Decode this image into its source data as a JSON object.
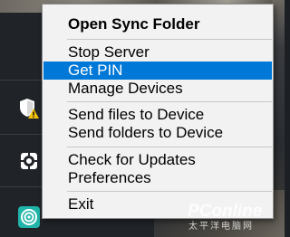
{
  "context_menu": {
    "groups": [
      {
        "items": [
          {
            "label": "Open Sync Folder",
            "bold": true
          }
        ]
      },
      {
        "items": [
          {
            "label": "Stop Server"
          },
          {
            "label": "Get PIN",
            "selected": true
          },
          {
            "label": "Manage Devices"
          }
        ]
      },
      {
        "items": [
          {
            "label": "Send files to Device"
          },
          {
            "label": "Send folders to Device"
          }
        ]
      },
      {
        "items": [
          {
            "label": "Check for Updates"
          },
          {
            "label": "Preferences"
          }
        ]
      },
      {
        "items": [
          {
            "label": "Exit"
          }
        ]
      }
    ]
  },
  "tray": {
    "icons": [
      {
        "name": "windows-security-icon",
        "has_warning": true
      },
      {
        "name": "app-settings-icon"
      },
      {
        "name": "teal-circle-app-icon"
      }
    ]
  },
  "watermark": {
    "logo_text": "PConline",
    "subtitle": "太平洋电脑网"
  },
  "colors": {
    "menu_background": "#f2f2f2",
    "selection": "#0078d7",
    "menu_text": "#000000",
    "tray_background": "#202429",
    "accent_teal": "#1fb5a8",
    "warning_yellow": "#f4c20d"
  }
}
